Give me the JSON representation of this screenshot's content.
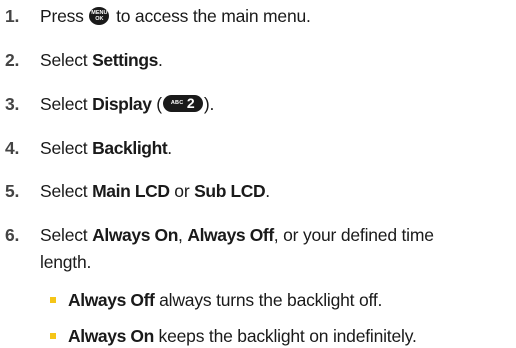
{
  "steps": [
    {
      "num": "1.",
      "pre": "Press",
      "key": {
        "line1": "MENU",
        "line2": "OK"
      },
      "post": "to access the main menu."
    },
    {
      "num": "2.",
      "pre": "Select",
      "bold": "Settings",
      "post": "."
    },
    {
      "num": "3.",
      "pre": "Select",
      "bold": "Display",
      "open": " (",
      "key": {
        "letters": "ABC",
        "digit": "2"
      },
      "close": ")."
    },
    {
      "num": "4.",
      "pre": "Select",
      "bold": "Backlight",
      "post": "."
    },
    {
      "num": "5.",
      "pre": "Select",
      "bold1": "Main LCD",
      "mid": "or",
      "bold2": "Sub LCD",
      "post": "."
    },
    {
      "num": "6.",
      "pre": "Select",
      "bold1": "Always On",
      "sep1": ",",
      "bold2": "Always Off",
      "sep2": ", or your defined time",
      "cont": "length."
    }
  ],
  "bullets": [
    {
      "bold": "Always Off",
      "text": "always turns the backlight off."
    },
    {
      "bold": "Always On",
      "text": "keeps the backlight on indefinitely."
    }
  ],
  "colors": {
    "bullet": "#f5c518",
    "key": "#1a1a1a"
  }
}
